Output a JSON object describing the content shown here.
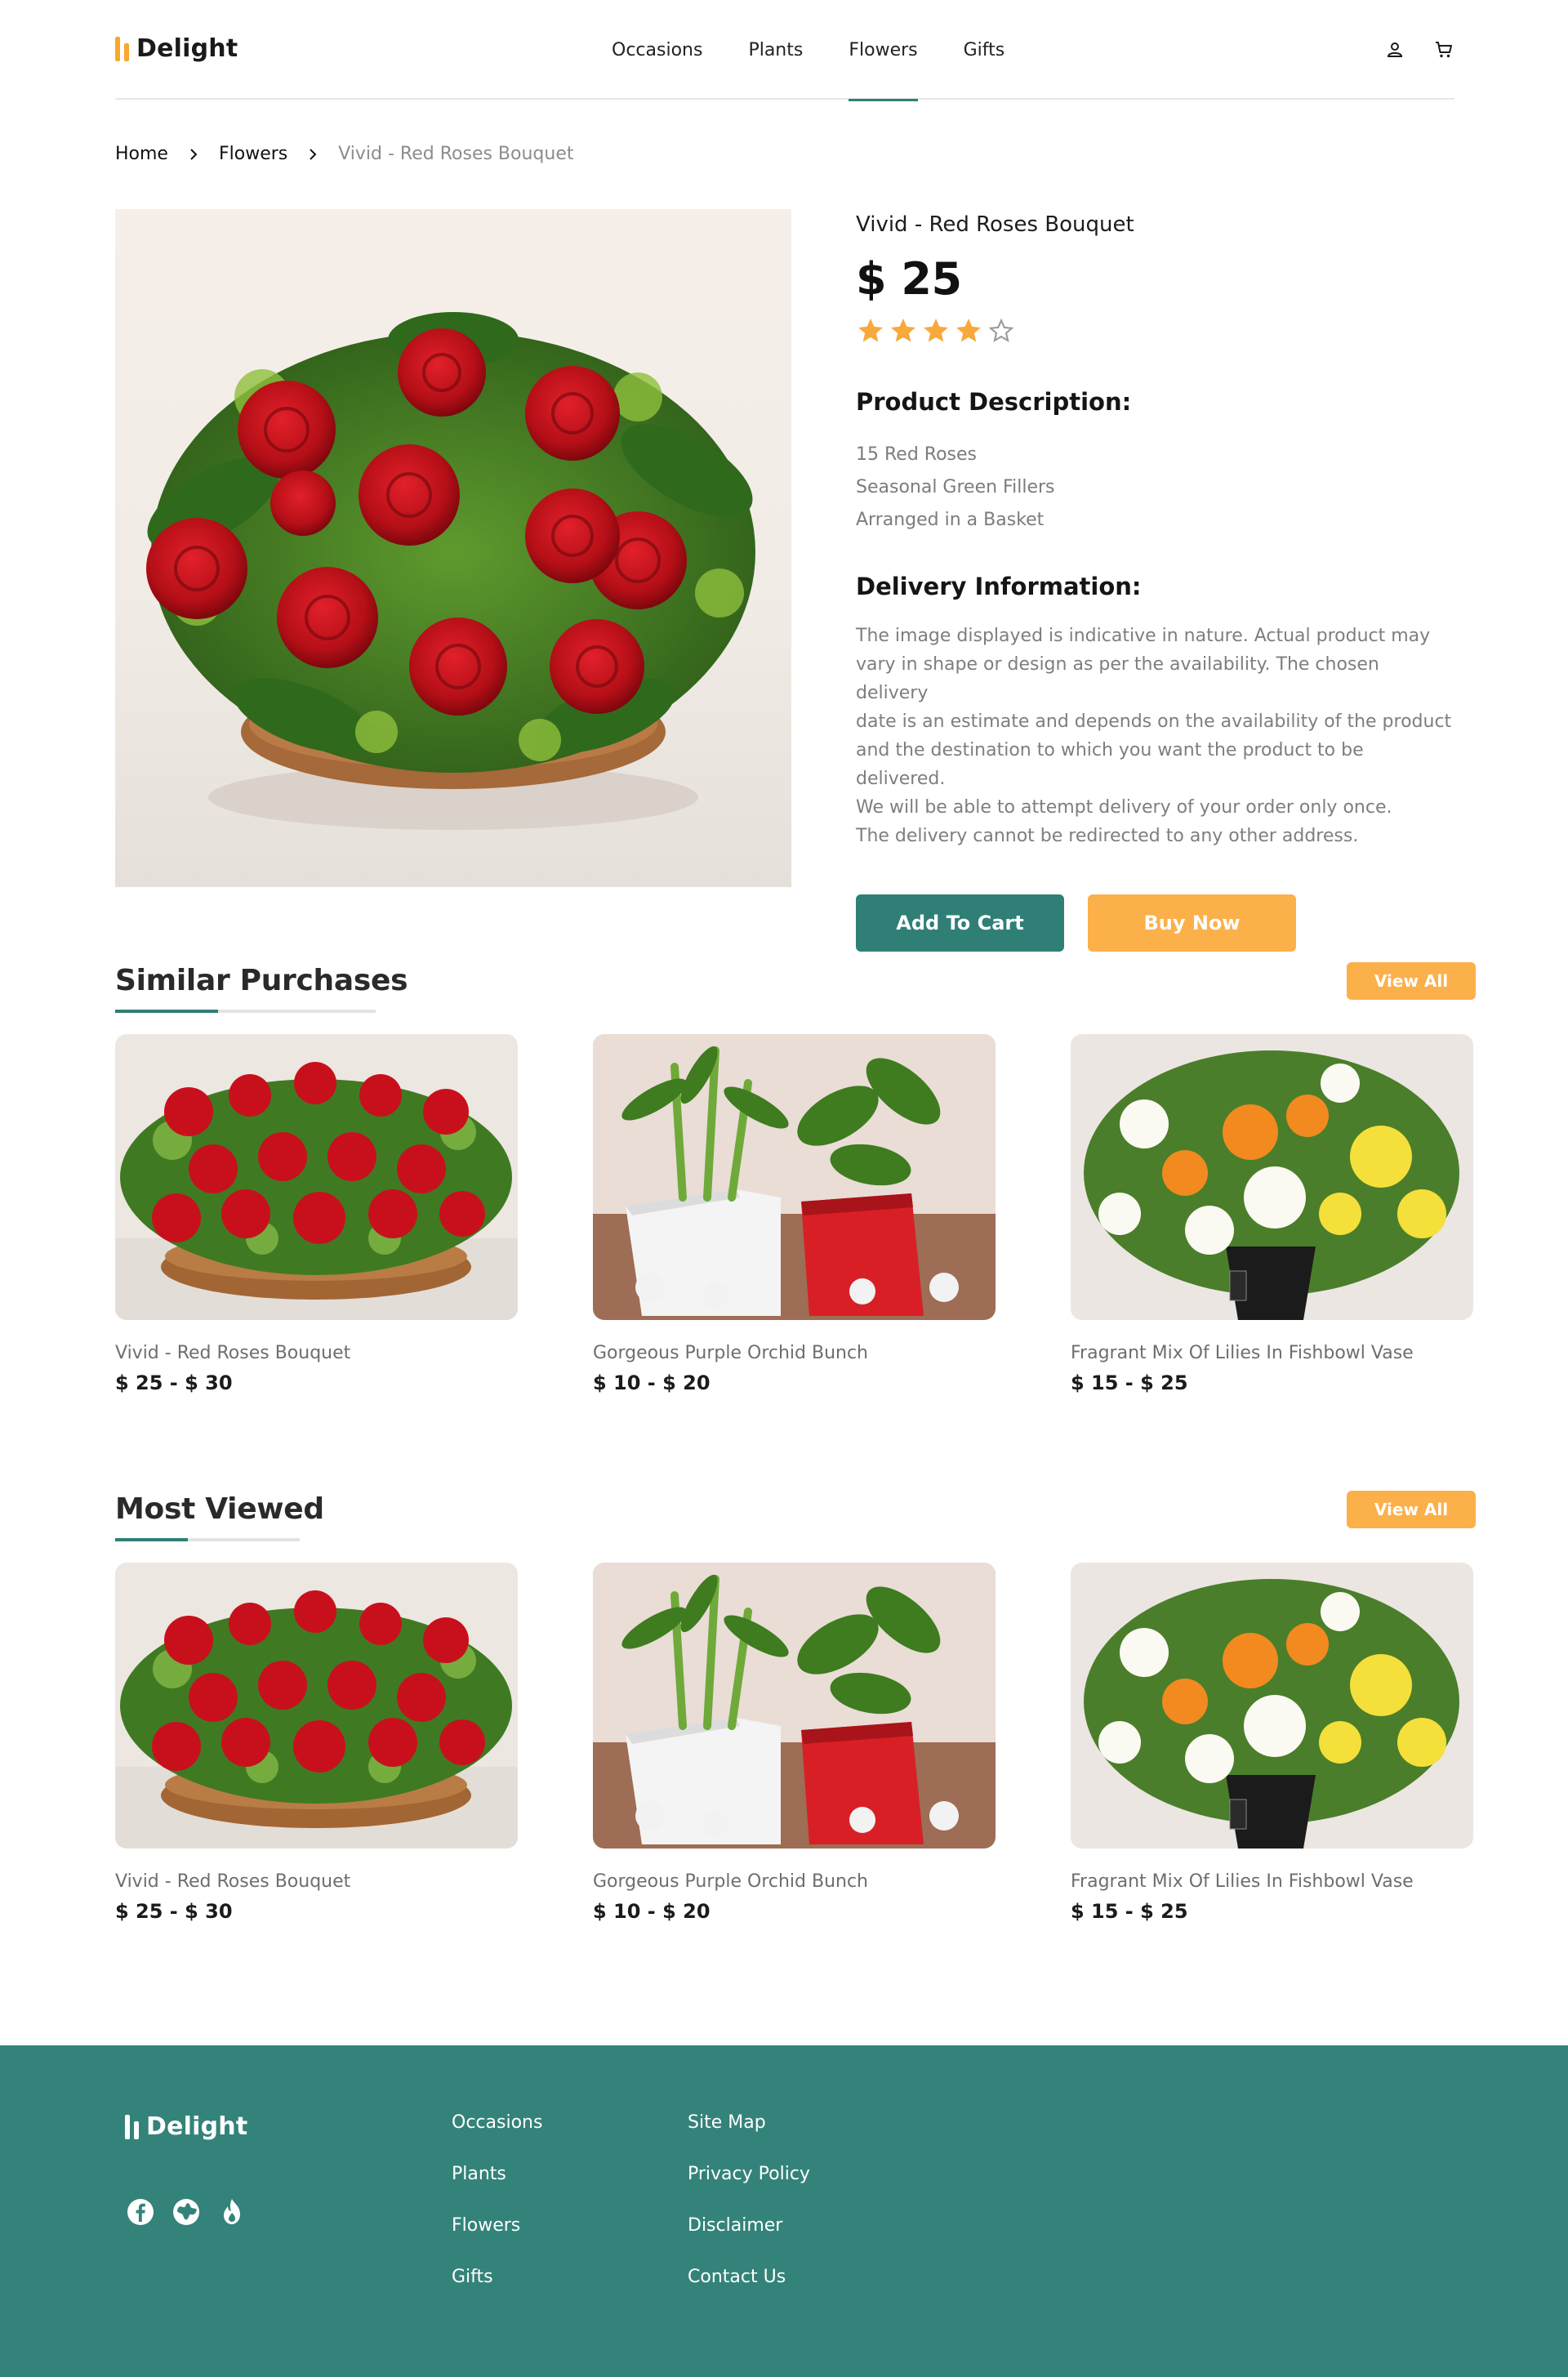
{
  "brand": {
    "name": "Delight"
  },
  "nav": {
    "items": [
      "Occasions",
      "Plants",
      "Flowers",
      "Gifts"
    ],
    "active": "Flowers"
  },
  "breadcrumb": [
    "Home",
    "Flowers",
    "Vivid - Red Roses Bouquet"
  ],
  "product": {
    "title": "Vivid - Red Roses Bouquet",
    "price": "$ 25",
    "rating": 4,
    "rating_max": 5,
    "description_heading": "Product Description:",
    "description_items": [
      "15 Red Roses",
      "Seasonal Green Fillers",
      "Arranged in a Basket"
    ],
    "delivery_heading": "Delivery Information:",
    "delivery_lines": [
      "The image displayed is indicative in nature. Actual product may",
      "vary in shape or design as per the availability. The chosen delivery",
      "date is an estimate and depends on the availability of the product",
      "and the destination to which you want the product to be delivered.",
      "We will be able to attempt delivery of your order only once.",
      "The delivery cannot be redirected to any other address."
    ],
    "add_to_cart_label": "Add To Cart",
    "buy_now_label": "Buy Now"
  },
  "similar": {
    "title": "Similar Purchases",
    "view_all_label": "View All",
    "items": [
      {
        "name": "Vivid - Red Roses Bouquet",
        "price": "$ 25 - $ 30"
      },
      {
        "name": "Gorgeous Purple Orchid Bunch",
        "price": "$ 10 - $ 20"
      },
      {
        "name": "Fragrant Mix Of Lilies In Fishbowl Vase",
        "price": "$ 15 - $ 25"
      }
    ]
  },
  "most_viewed": {
    "title": "Most Viewed",
    "view_all_label": "View All",
    "items": [
      {
        "name": "Vivid - Red Roses Bouquet",
        "price": "$ 25 - $ 30"
      },
      {
        "name": "Gorgeous Purple Orchid Bunch",
        "price": "$ 10 - $ 20"
      },
      {
        "name": "Fragrant Mix Of Lilies In Fishbowl Vase",
        "price": "$ 15 - $ 25"
      }
    ]
  },
  "footer": {
    "brand": "Delight",
    "col1": [
      "Occasions",
      "Plants",
      "Flowers",
      "Gifts"
    ],
    "col2": [
      "Site Map",
      "Privacy Policy",
      "Disclaimer",
      "Contact Us"
    ],
    "social_icons": [
      "facebook-icon",
      "globe-icon",
      "fire-icon"
    ]
  },
  "colors": {
    "primary": "#2f7f77",
    "accent": "#fbb04a",
    "footer_bg": "#33837a",
    "star": "#f7a93b"
  }
}
